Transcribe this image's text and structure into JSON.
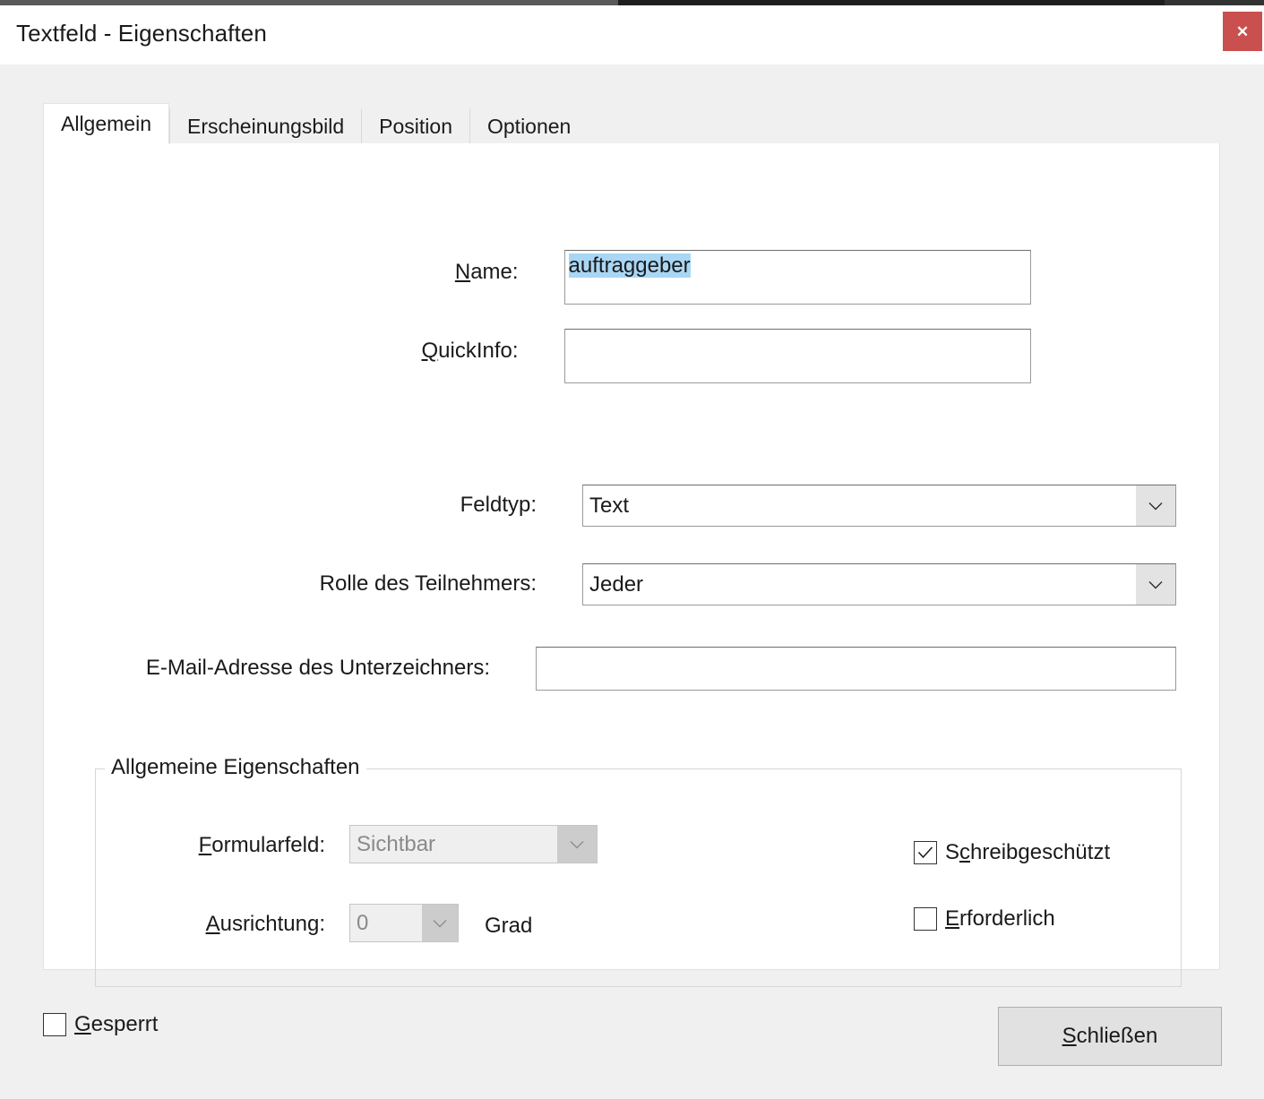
{
  "window": {
    "title": "Textfeld - Eigenschaften",
    "close_glyph": "✕",
    "accent_close_color": "#c9504f"
  },
  "tabs": [
    {
      "label": "Allgemein",
      "active": true
    },
    {
      "label": "Erscheinungsbild",
      "active": false
    },
    {
      "label": "Position",
      "active": false
    },
    {
      "label": "Optionen",
      "active": false
    }
  ],
  "general_tab": {
    "name_field": {
      "label_pre": "",
      "label_acc": "N",
      "label_post": "ame:",
      "value": "auftraggeber",
      "selected": true
    },
    "quickinfo_field": {
      "label_pre": "",
      "label_acc": "Q",
      "label_post": "uickInfo:",
      "value": ""
    },
    "fieldtype": {
      "label": "Feldtyp:",
      "value": "Text",
      "options": [
        "Text"
      ]
    },
    "participant_role": {
      "label": "Rolle des Teilnehmers:",
      "value": "Jeder",
      "options": [
        "Jeder"
      ]
    },
    "signer_email": {
      "label": "E-Mail-Adresse des Unterzeichners:",
      "value": ""
    },
    "groupbox": {
      "title": "Allgemeine Eigenschaften",
      "form_field": {
        "label_acc": "F",
        "label_post": "ormularfeld:",
        "value": "Sichtbar",
        "disabled": true,
        "options": [
          "Sichtbar"
        ]
      },
      "orientation": {
        "label_acc": "A",
        "label_post": "usrichtung:",
        "value": "0",
        "unit": "Grad",
        "disabled": true,
        "options": [
          "0"
        ]
      },
      "readonly_checkbox": {
        "label_pre": "S",
        "label_acc": "c",
        "label_post": "hreibgeschützt",
        "checked": true
      },
      "required_checkbox": {
        "label_pre": "",
        "label_acc": "E",
        "label_post": "rforderlich",
        "checked": false
      }
    }
  },
  "footer": {
    "locked_checkbox": {
      "label_pre": "",
      "label_acc": "G",
      "label_post": "esperrt",
      "checked": false
    },
    "close_button": {
      "label_pre": "",
      "label_acc": "S",
      "label_post": "chließen"
    }
  }
}
